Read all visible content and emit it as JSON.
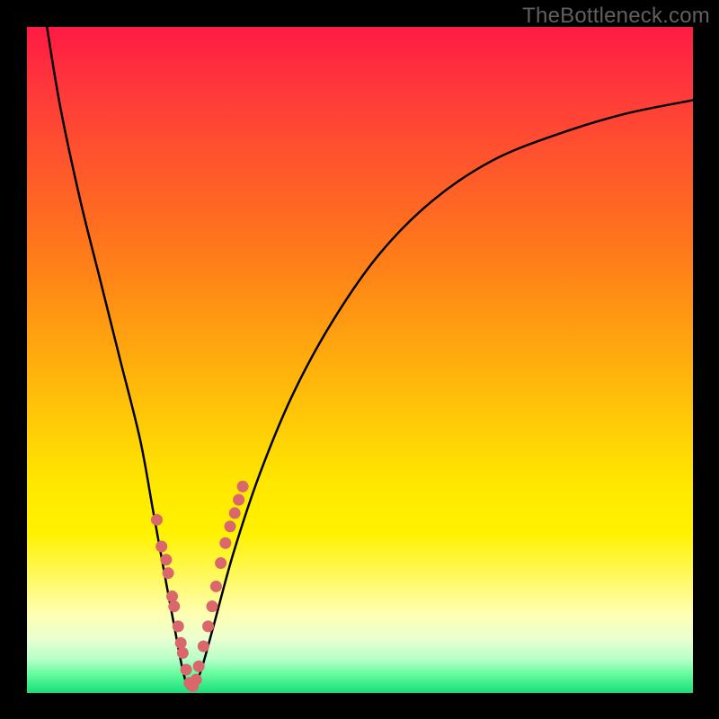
{
  "watermark": "TheBottleneck.com",
  "chart_data": {
    "type": "line",
    "title": "",
    "xlabel": "",
    "ylabel": "",
    "xlim": [
      0,
      100
    ],
    "ylim": [
      0,
      100
    ],
    "grid": false,
    "series": [
      {
        "name": "bottleneck-curve",
        "x": [
          3,
          5,
          8,
          11,
          14,
          17,
          19,
          21,
          22.5,
          23.5,
          24.5,
          26,
          28,
          31,
          35,
          40,
          46,
          53,
          61,
          70,
          80,
          90,
          100
        ],
        "values": [
          100,
          88,
          74,
          62,
          50,
          38,
          27,
          16,
          8,
          3,
          0.5,
          3,
          10,
          21,
          33,
          45,
          56,
          66,
          74,
          80,
          84,
          87,
          89
        ]
      }
    ],
    "markers": {
      "name": "highlight-dots",
      "color": "#d9676b",
      "x": [
        19.5,
        20.2,
        20.9,
        21.2,
        21.8,
        22.1,
        22.7,
        23.1,
        23.4,
        23.9,
        24.4,
        24.9,
        25.4,
        25.8,
        26.5,
        27.2,
        27.8,
        28.4,
        29.1,
        29.8,
        30.5,
        31.2,
        31.8,
        32.4
      ],
      "values": [
        26,
        22,
        20,
        18,
        14.5,
        13,
        10,
        7.5,
        6,
        3.5,
        1.5,
        1,
        2,
        4,
        7,
        10,
        13,
        16,
        19.5,
        22.5,
        25,
        27,
        29,
        31
      ]
    }
  },
  "colors": {
    "heat_top": "#ff1a44",
    "heat_bottom": "#16e07a",
    "curve": "#000000",
    "marker": "#d9676b",
    "background": "#000000"
  }
}
